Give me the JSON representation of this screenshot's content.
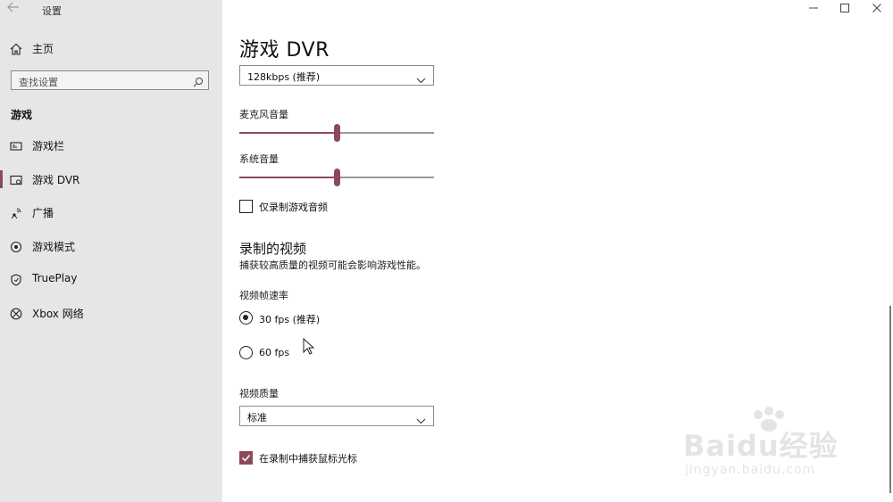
{
  "window": {
    "app_title": "设置",
    "minimize_icon": "minimize-icon",
    "maximize_icon": "maximize-icon",
    "close_icon": "close-icon"
  },
  "sidebar": {
    "home_label": "主页",
    "search_placeholder": "查找设置",
    "section_label": "游戏",
    "items": [
      {
        "label": "游戏栏",
        "icon": "game-bar-icon",
        "active": false
      },
      {
        "label": "游戏 DVR",
        "icon": "game-dvr-icon",
        "active": true
      },
      {
        "label": "广播",
        "icon": "broadcast-icon",
        "active": false
      },
      {
        "label": "游戏模式",
        "icon": "game-mode-icon",
        "active": false
      },
      {
        "label": "TruePlay",
        "icon": "trueplay-icon",
        "active": false
      },
      {
        "label": "Xbox 网络",
        "icon": "xbox-icon",
        "active": false
      }
    ]
  },
  "main": {
    "title": "游戏 DVR",
    "audio_quality_value": "128kbps (推荐)",
    "mic_volume": {
      "label": "麦克风音量",
      "value": 0.5
    },
    "system_volume": {
      "label": "系统音量",
      "value": 0.5
    },
    "game_audio_only": {
      "label": "仅录制游戏音频",
      "checked": false
    },
    "recorded_video": {
      "heading": "录制的视频",
      "description": "捕获较高质量的视频可能会影响游戏性能。",
      "frame_rate_label": "视频帧速率",
      "frame_rate_options": [
        {
          "label": "30 fps (推荐)",
          "selected": true
        },
        {
          "label": "60 fps",
          "selected": false
        }
      ],
      "quality_label": "视频质量",
      "quality_value": "标准",
      "capture_cursor": {
        "label": "在录制中捕获鼠标光标",
        "checked": true
      }
    }
  },
  "watermark": {
    "brand": "Baidu经验",
    "url": "jingyan.baidu.com"
  },
  "colors": {
    "accent": "#8b4a5c",
    "sidebar_bg": "#e6e6e6"
  }
}
